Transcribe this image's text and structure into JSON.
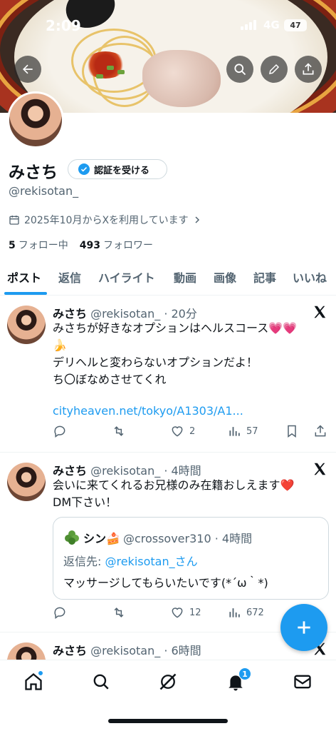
{
  "status": {
    "time": "2:09",
    "network": "4G",
    "battery": "47"
  },
  "profile": {
    "name": "みさち",
    "verify_label": "認証を受ける",
    "handle": "@rekisotan_",
    "joined": "2025年10月からXを利用しています",
    "following_count": "5",
    "following_label": "フォロー中",
    "followers_count": "493",
    "followers_label": "フォロワー"
  },
  "tabs": [
    {
      "label": "ポスト"
    },
    {
      "label": "返信"
    },
    {
      "label": "ハイライト"
    },
    {
      "label": "動画"
    },
    {
      "label": "画像"
    },
    {
      "label": "記事"
    },
    {
      "label": "いいね"
    }
  ],
  "tweets": [
    {
      "name": "みさち",
      "meta": "@rekisotan_ · 20分",
      "text": "みさちが好きなオプションはヘルスコース💗💗\n🍌\nデリヘルと変わらないオプションだよ！\nち〇ぼなめさせてくれ",
      "link": "cityheaven.net/tokyo/A1303/A1...",
      "reply": "",
      "retweet": "",
      "like": "2",
      "views": "57"
    },
    {
      "name": "みさち",
      "meta": "@rekisotan_ · 4時間",
      "text": "会いに来てくれるお兄様のみ在籍おしえます❤️\nDM下さい！",
      "quote": {
        "name": "シン🍰",
        "meta": "@crossover310 · 4時間",
        "reply_prefix": "返信先: ",
        "reply_to": "@rekisotan_さん",
        "text": "マッサージしてもらいたいです(*´ω｀*)"
      },
      "like": "12",
      "views": "672"
    },
    {
      "name": "みさち",
      "meta": "@rekisotan_ · 6時間"
    }
  ],
  "nav": {
    "notifications_badge": "1"
  },
  "colors": {
    "accent": "#1d9bf0",
    "text": "#0f1419",
    "muted": "#536471"
  },
  "icons": [
    "back-arrow-icon",
    "search-icon",
    "edit-icon",
    "share-icon",
    "calendar-icon",
    "chevron-right-icon",
    "verified-badge-icon",
    "x-logo-icon",
    "reply-icon",
    "retweet-icon",
    "like-icon",
    "views-icon",
    "bookmark-icon",
    "plus-icon",
    "home-icon",
    "grok-icon",
    "bell-icon",
    "mail-icon"
  ]
}
